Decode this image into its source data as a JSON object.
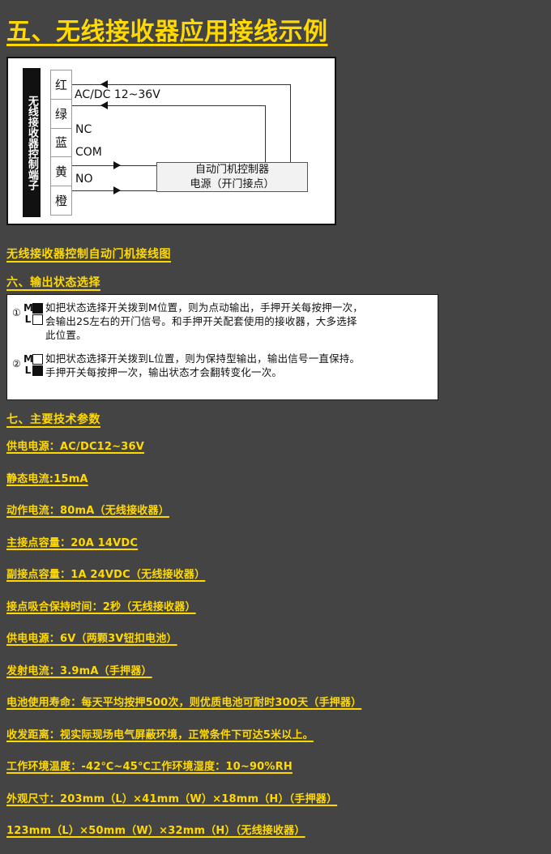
{
  "page": {
    "background_color": "#444444",
    "accent_color": "#ffd900"
  },
  "title": "五、无线接收器应用接线示例",
  "diagram": {
    "terminal_name": "无线接收器控制端子",
    "terminals": [
      {
        "color_label": "红"
      },
      {
        "color_label": "绿"
      },
      {
        "color_label": "蓝"
      },
      {
        "color_label": "黄"
      },
      {
        "color_label": "橙"
      }
    ],
    "wire_labels": {
      "power": "AC/DC 12~36V",
      "nc": "NC",
      "com": "COM",
      "no": "NO"
    },
    "controller_box": {
      "line1": "自动门机控制器",
      "line2": "电源（开门接点）"
    },
    "caption": "无线接收器控制自动门机接线图"
  },
  "section_six": {
    "title": "六、输出状态选择",
    "items": [
      {
        "index": "①",
        "switch": {
          "top_label": "M",
          "top_state": "on",
          "bottom_label": "L",
          "bottom_state": "off"
        },
        "lines": [
          "如把状态选择开关拨到M位置，则为点动输出，手押开关每按押一次，",
          "会输出2S左右的开门信号。和手押开关配套使用的接收器，大多选择",
          "此位置。"
        ]
      },
      {
        "index": "②",
        "switch": {
          "top_label": "M",
          "top_state": "off",
          "bottom_label": "L",
          "bottom_state": "on"
        },
        "lines": [
          "如把状态选择开关拨到L位置，则为保持型输出，输出信号一直保持。",
          "手押开关每按押一次，输出状态才会翻转变化一次。"
        ]
      }
    ]
  },
  "section_seven": {
    "title": "七、主要技术参数",
    "specs": [
      "供电电源：AC/DC12~36V",
      "静态电流:15mA",
      "动作电流：80mA（无线接收器）",
      "主接点容量：20A 14VDC",
      "副接点容量：1A 24VDC（无线接收器）",
      "接点吸合保持时间：2秒（无线接收器）",
      "供电电源：6V（两颗3V钮扣电池）",
      "发射电流：3.9mA（手押器）",
      "电池使用寿命：每天平均按押500次，则优质电池可耐时300天（手押器）",
      "收发距离：视实际现场电气屏蔽环境，正常条件下可达5米以上。",
      "工作环境温度：-42℃~45℃工作环境湿度：10~90%RH",
      "外观尺寸：203mm（L）×41mm（W）×18mm（H）（手押器）",
      "123mm（L）×50mm（W）×32mm（H）（无线接收器）"
    ]
  }
}
